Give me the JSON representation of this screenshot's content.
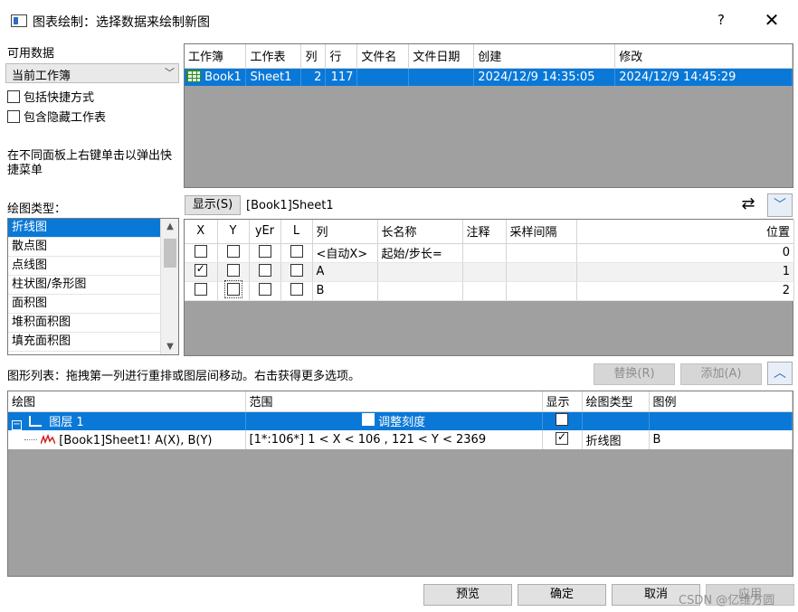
{
  "window": {
    "title": "图表绘制：选择数据来绘制新图",
    "help": "?",
    "close": "✕"
  },
  "available_data": {
    "label": "可用数据",
    "source": "当前工作簿",
    "include_shortcuts": "包括快捷方式",
    "include_hidden": "包含隐藏工作表",
    "hint": "在不同面板上右键单击以弹出快捷菜单"
  },
  "workbook_table": {
    "headers": [
      "工作簿",
      "工作表",
      "列",
      "行",
      "文件名",
      "文件日期",
      "创建",
      "修改"
    ],
    "rows": [
      {
        "book": "Book1",
        "sheet": "Sheet1",
        "cols": "2",
        "rows": "117",
        "filename": "",
        "filedate": "",
        "created": "2024/12/9 14:35:05",
        "modified": "2024/12/9 14:45:29"
      }
    ]
  },
  "plot_type": {
    "label": "绘图类型：",
    "items": [
      "折线图",
      "散点图",
      "点线图",
      "柱状图/条形图",
      "面积图",
      "堆积面积图",
      "填充面积图",
      "..."
    ]
  },
  "columns_panel": {
    "show_button": "显示(S)",
    "sheet_ref": "[Book1]Sheet1",
    "headers": [
      "X",
      "Y",
      "yEr",
      "L",
      "列",
      "长名称",
      "注释",
      "采样间隔",
      "位置"
    ],
    "rows": [
      {
        "x": false,
        "y": false,
        "yer": false,
        "l": false,
        "col": "<自动X>",
        "longname": "起始/步长=",
        "comment": "",
        "interval": "",
        "pos": "0"
      },
      {
        "x": true,
        "y": false,
        "yer": false,
        "l": false,
        "col": "A",
        "longname": "",
        "comment": "",
        "interval": "",
        "pos": "1"
      },
      {
        "x": false,
        "y": false,
        "yer": false,
        "l": false,
        "col": "B",
        "longname": "",
        "comment": "",
        "interval": "",
        "pos": "2"
      }
    ]
  },
  "graph_list": {
    "hint": "图形列表：拖拽第一列进行重排或图层间移动。右击获得更多选项。",
    "replace": "替换(R)",
    "add": "添加(A)",
    "headers": [
      "绘图",
      "范围",
      "显示",
      "绘图类型",
      "图例"
    ],
    "layer": {
      "name": "图层 1",
      "rescale": "调整刻度"
    },
    "plot": {
      "name": "[Book1]Sheet1! A(X), B(Y)",
      "range": "[1*:106*]  1 < X < 106 , 121 < Y < 2369",
      "type": "折线图",
      "legend": "B"
    }
  },
  "footer": {
    "preview": "预览",
    "ok": "确定",
    "cancel": "取消",
    "apply": "应用",
    "watermark": "CSDN @亿维方圆"
  },
  "colors": {
    "selection": "#0a78d7",
    "panel_gray": "#a0a0a0"
  }
}
